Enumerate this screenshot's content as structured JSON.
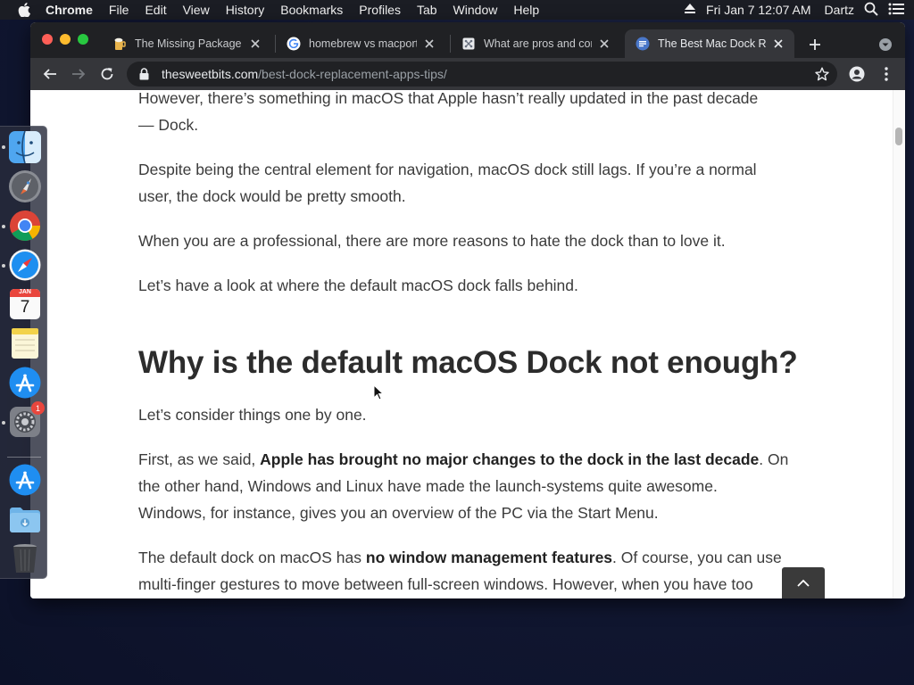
{
  "menubar": {
    "app_name": "Chrome",
    "items": [
      "File",
      "Edit",
      "View",
      "History",
      "Bookmarks",
      "Profiles",
      "Tab",
      "Window",
      "Help"
    ],
    "clock": "Fri Jan 7  12:07 AM",
    "user": "Dartz"
  },
  "browser": {
    "tabs": [
      {
        "title": "The Missing Package M",
        "icon": "homebrew-icon"
      },
      {
        "title": "homebrew vs macports",
        "icon": "google-icon"
      },
      {
        "title": "What are pros and con",
        "icon": "stackexchange-icon"
      },
      {
        "title": "The Best Mac Dock Re",
        "icon": "sweetbits-icon",
        "active": true
      }
    ],
    "url_domain": "thesweetbits.com",
    "url_path": "/best-dock-replacement-apps-tips/"
  },
  "article": {
    "p1_line1": "However, there’s something in macOS that Apple hasn’t really updated in the past decade",
    "p1_line2": "— Dock.",
    "p2_line1": "Despite being the central element for navigation, macOS dock still lags. If you’re a normal",
    "p2_line2": "user, the dock would be pretty smooth.",
    "p3": "When you are a professional, there are more reasons to hate the dock than to love it.",
    "p4": "Let’s have a look at where the default macOS dock falls behind.",
    "heading": "Why is the default macOS Dock not enough?",
    "p5": "Let’s consider things one by one.",
    "p6_line1_a": "First, as we said, ",
    "p6_line1_b": "Apple has brought no major changes to the dock in the last decade",
    "p6_line1_c": ". On",
    "p6_line2": "the other hand, Windows and Linux have made the launch-systems quite awesome.",
    "p6_line3": "Windows, for instance, gives you an overview of the PC via the Start Menu.",
    "p7_line1_a": "The default dock on macOS has ",
    "p7_line1_b": "no window management features",
    "p7_line1_c": ". Of course, you can use",
    "p7_line2": "multi-finger gestures to move between full-screen windows. However, when you have too"
  },
  "dock": {
    "items": [
      "finder-icon",
      "launchpad-icon",
      "chrome-icon",
      "safari-icon",
      "calendar-icon",
      "notes-icon",
      "app-store-icon",
      "system-preferences-icon",
      "app-store-downloads-icon",
      "downloads-folder-icon",
      "trash-icon"
    ],
    "calendar_month": "JAN",
    "calendar_day": "7",
    "system_preferences_badge": "1"
  }
}
